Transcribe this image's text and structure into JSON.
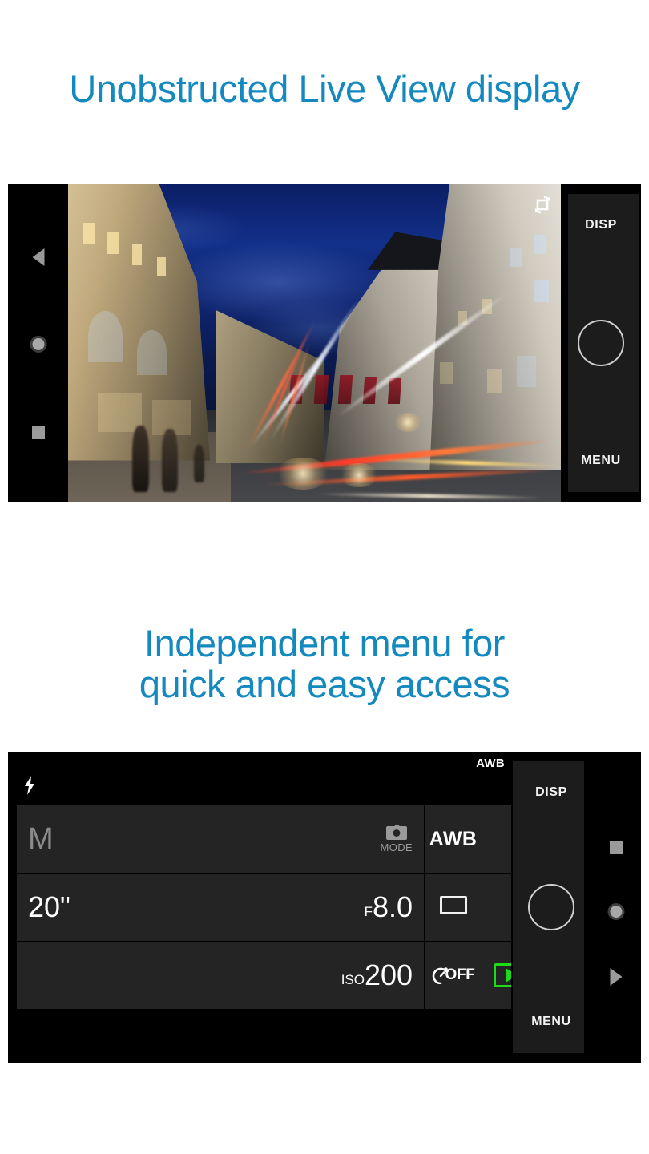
{
  "theme": {
    "accent_blue": "#1489c0",
    "panel_black": "#000000",
    "cell_grey": "#242424",
    "play_green": "#18dd18",
    "page_background": "#ffffff"
  },
  "headings": {
    "first": "Unobstructed Live View display",
    "second_line1": "Independent menu for",
    "second_line2": "quick and easy access"
  },
  "liveview": {
    "scene_description": "Night city street long-exposure with light trails and illuminated buildings",
    "rotate_icon": "screen-rotate-icon",
    "nav": {
      "back": "back-icon",
      "home": "home-icon",
      "recents": "recents-icon"
    },
    "camera_panel": {
      "disp_label": "DISP",
      "menu_label": "MENU",
      "shutter": "shutter-button"
    }
  },
  "menu": {
    "status_bar": {
      "flash_icon": "flash-icon",
      "white_balance_top": "AWB"
    },
    "rows": [
      {
        "left_value": "M",
        "left_is_dim": true,
        "mode_icon": "camera-icon",
        "mode_label": "MODE",
        "mid_cell": "AWB",
        "mid_icon": "",
        "end_icon": ""
      },
      {
        "left_value": "20\"",
        "right_prefix": "F",
        "right_value": "8.0",
        "mid_icon": "single-shot-rectangle-icon",
        "end_icon": ""
      },
      {
        "left_value": "",
        "right_prefix": "ISO",
        "right_value": "200",
        "mid_icon": "self-timer-icon",
        "mid_label": "OFF",
        "end_icon": "playback-icon"
      }
    ],
    "camera_panel": {
      "disp_label": "DISP",
      "menu_label": "MENU",
      "shutter": "shutter-button"
    },
    "nav": {
      "recents": "recents-icon",
      "home": "home-icon",
      "back": "back-icon"
    }
  }
}
